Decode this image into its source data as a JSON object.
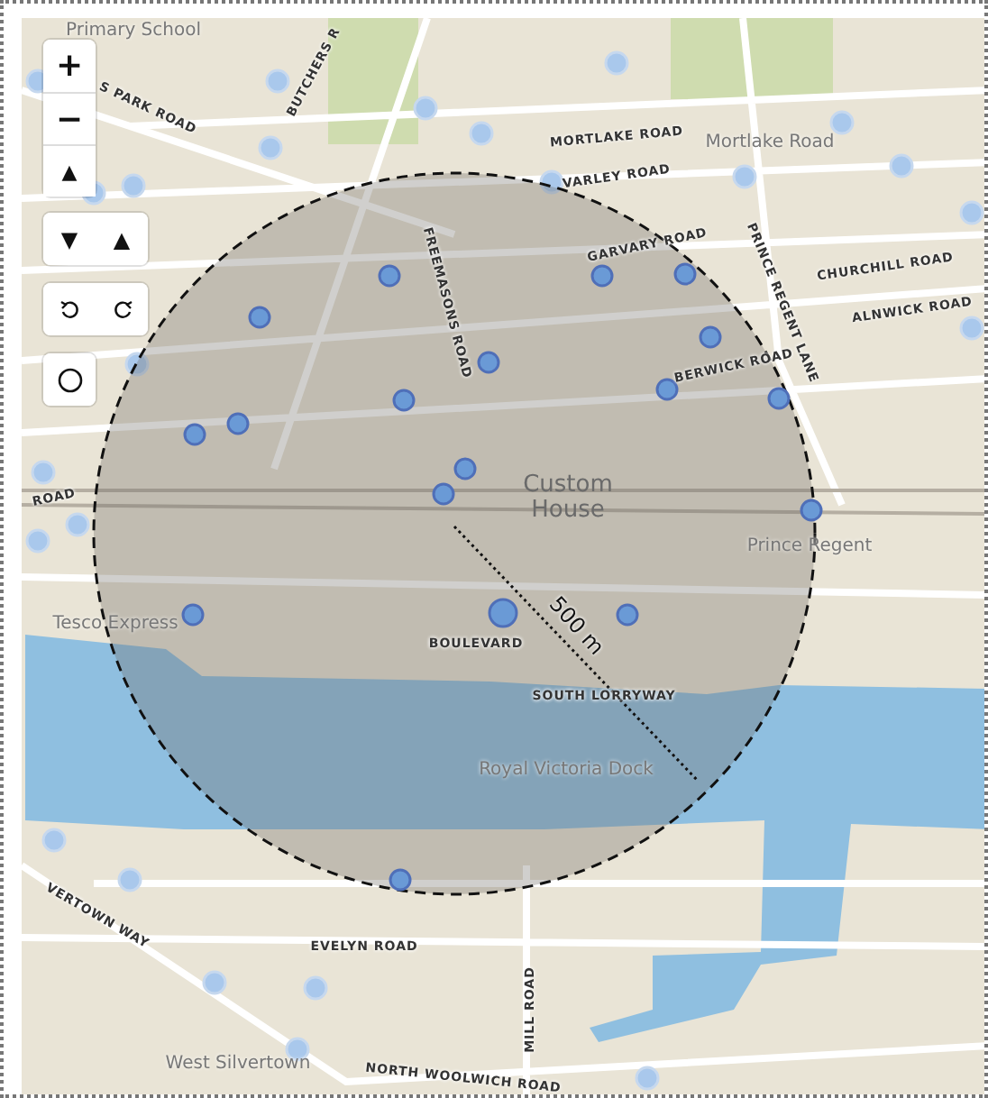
{
  "controls": {
    "zoom_in": "+",
    "zoom_out": "−",
    "compass": "▲",
    "tilt": [
      {
        "label": "▼"
      },
      {
        "label": "▲"
      }
    ]
  },
  "map_labels": [
    {
      "text": "Primary School",
      "kind": "place"
    },
    {
      "text": "S PARK ROAD",
      "kind": "street"
    },
    {
      "text": "BUTCHERS R",
      "kind": "street"
    },
    {
      "text": "MORTLAKE ROAD",
      "kind": "street"
    },
    {
      "text": "Mortlake Road",
      "kind": "place"
    },
    {
      "text": "VARLEY ROAD",
      "kind": "street"
    },
    {
      "text": "GARVARY ROAD",
      "kind": "street"
    },
    {
      "text": "FREEMASONS ROAD",
      "kind": "street"
    },
    {
      "text": "PRINCE REGENT LANE",
      "kind": "street"
    },
    {
      "text": "CHURCHILL ROAD",
      "kind": "street"
    },
    {
      "text": "ALNWICK ROAD",
      "kind": "street"
    },
    {
      "text": "BERWICK ROAD",
      "kind": "street"
    },
    {
      "text": "ROAD",
      "kind": "street"
    },
    {
      "text": "Custom House",
      "kind": "area"
    },
    {
      "text": "Prince Regent",
      "kind": "place"
    },
    {
      "text": "Tesco Express",
      "kind": "place"
    },
    {
      "text": "BOULEVARD",
      "kind": "street"
    },
    {
      "text": "SOUTH LORRYWAY",
      "kind": "street"
    },
    {
      "text": "Royal Victoria Dock",
      "kind": "place"
    },
    {
      "text": "VERTOWN WAY",
      "kind": "street"
    },
    {
      "text": "EVELYN ROAD",
      "kind": "street"
    },
    {
      "text": "MILL ROAD",
      "kind": "street"
    },
    {
      "text": "West Silvertown",
      "kind": "place"
    },
    {
      "text": "NORTH WOOLWICH ROAD",
      "kind": "street"
    }
  ],
  "radius_label": "500 m"
}
